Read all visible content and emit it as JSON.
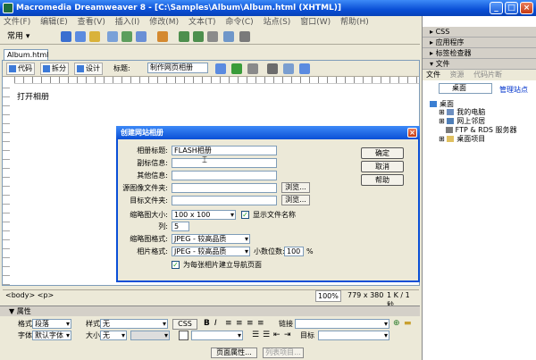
{
  "window": {
    "title": "Macromedia Dreamweaver 8 - [C:\\Samples\\Album\\Album.html (XHTML)]",
    "min": "_",
    "max": "□",
    "close": "×"
  },
  "menu": [
    "文件(F)",
    "编辑(E)",
    "查看(V)",
    "插入(I)",
    "修改(M)",
    "文本(T)",
    "命令(C)",
    "站点(S)",
    "窗口(W)",
    "帮助(H)"
  ],
  "insertbar": {
    "category": "常用"
  },
  "document": {
    "tab": "Album.html",
    "toolbar": {
      "code": "代码",
      "split": "拆分",
      "design": "设计",
      "title_label": "标题:",
      "title_value": "制作网页相册"
    },
    "body_text": "打开相册"
  },
  "statusbar": {
    "tag": "<body> <p>",
    "zoom": "100%",
    "size": "779 x 380",
    "weight": "1 K / 1 秒"
  },
  "properties": {
    "header": "属性",
    "format_label": "格式",
    "format_value": "段落",
    "style_label": "样式",
    "style_value": "无",
    "css_label": "CSS",
    "link_label": "链接",
    "font_label": "字体",
    "font_value": "默认字体",
    "size_label": "大小",
    "size_value": "无",
    "target_label": "目标",
    "page_props": "页面属性...",
    "list_item": "列表项目..."
  },
  "right_panel": {
    "css": "CSS",
    "app": "应用程序",
    "tag_inspector": "标签检查器",
    "files": "文件",
    "tabs": [
      "文件",
      "资源",
      "代码片断"
    ],
    "site_select": "桌面",
    "manage": "管理站点",
    "tree": [
      "桌面",
      "我的电脑",
      "网上邻居",
      "FTP & RDS 服务器",
      "桌面项目"
    ]
  },
  "dialog": {
    "title": "创建网站相册",
    "album_title_label": "相册标题:",
    "album_title_value": "FLASH相册",
    "sub1_label": "副标信息:",
    "sub2_label": "其他信息:",
    "source_label": "源图像文件夹:",
    "dest_label": "目标文件夹:",
    "browse": "浏览...",
    "thumb_size_label": "缩略图大小:",
    "thumb_size_value": "100 x 100",
    "show_names": "显示文件名称",
    "cols_label": "列:",
    "cols_value": "5",
    "thumb_format_label": "缩略图格式:",
    "thumb_format_value": "JPEG - 较高品质",
    "photo_format_label": "相片格式:",
    "photo_format_value": "JPEG - 较高品质",
    "scale_label": "小数位数:",
    "scale_value": "100",
    "scale_unit": "%",
    "nav_pages": "为每张相片建立导航页面",
    "ok": "确定",
    "cancel": "取消",
    "help": "帮助"
  }
}
